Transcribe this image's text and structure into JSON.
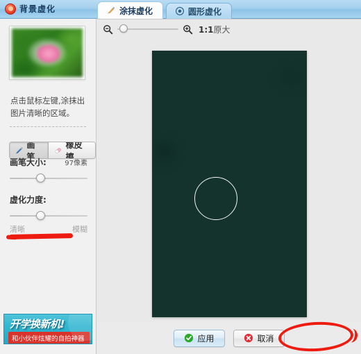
{
  "window": {
    "title": "背景虚化",
    "logo_icon": "app-logo-icon"
  },
  "tabs": [
    {
      "label": "涂抹虚化",
      "icon": "brush-icon",
      "active": true
    },
    {
      "label": "圆形虚化",
      "icon": "circle-target-icon",
      "active": false
    }
  ],
  "sidebar": {
    "preview_alt": "预览图",
    "hint": "点击鼠标左键,涂抹出图片清晰的区域。",
    "tools": [
      {
        "label": "画笔",
        "icon": "pen-icon",
        "selected": true
      },
      {
        "label": "橡皮擦",
        "icon": "eraser-icon",
        "selected": false
      }
    ],
    "brush_size": {
      "label": "画笔大小:",
      "value": "97像素",
      "knob_percent": 38
    },
    "blur_strength": {
      "label": "虚化力度:",
      "min_label": "清晰",
      "max_label": "模糊",
      "knob_percent": 38
    },
    "ad": {
      "line1": "开学换新机!",
      "line2": "和小伙伴炫耀的自拍神器"
    }
  },
  "main": {
    "zoom": {
      "zoom_out_icon": "magnifier-minus-icon",
      "zoom_in_icon": "magnifier-plus-icon",
      "level_label": "1:1",
      "level_sub": "原大",
      "slider_percent": 4
    },
    "canvas": {
      "brush_cursor_name": "brush-circle-cursor"
    },
    "actions": [
      {
        "label": "应用",
        "icon": "check-circle-icon",
        "kind": "apply"
      },
      {
        "label": "取消",
        "icon": "x-circle-icon",
        "kind": "cancel"
      }
    ]
  },
  "colors": {
    "accent_blue": "#8dc3e8",
    "annotation_red": "#ee1b10",
    "apply_green": "#2ba828",
    "cancel_red": "#e0303a"
  }
}
